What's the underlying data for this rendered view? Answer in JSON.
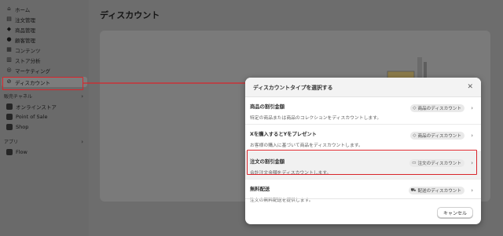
{
  "sidebar": {
    "items": [
      {
        "icon": "home-icon",
        "glyph": "⌂",
        "label": "ホーム"
      },
      {
        "icon": "orders-icon",
        "glyph": "▤",
        "label": "注文管理"
      },
      {
        "icon": "tag-icon",
        "glyph": "◆",
        "label": "商品管理"
      },
      {
        "icon": "person-icon",
        "glyph": "●",
        "label": "顧客管理"
      },
      {
        "icon": "content-icon",
        "glyph": "▦",
        "label": "コンテンツ"
      },
      {
        "icon": "bar-chart-icon",
        "glyph": "▥",
        "label": "ストア分析"
      },
      {
        "icon": "target-icon",
        "glyph": "◎",
        "label": "マーケティング"
      },
      {
        "icon": "discount-icon",
        "glyph": "⊘",
        "label": "ディスカウント"
      }
    ],
    "sales_channels_label": "販売チャネル",
    "channels": [
      {
        "label": "オンラインストア"
      },
      {
        "label": "Point of Sale"
      },
      {
        "label": "Shop"
      }
    ],
    "apps_label": "アプリ",
    "apps": [
      {
        "label": "Flow"
      }
    ]
  },
  "main": {
    "title": "ディスカウント"
  },
  "modal": {
    "title": "ディスカウントタイプを選択する",
    "options": [
      {
        "title": "商品の割引金額",
        "desc": "特定の商品または商品のコレクションをディスカウントします。",
        "badge": "商品のディスカウント",
        "badge_icon": "tag-icon"
      },
      {
        "title": "Xを購入するとYをプレゼント",
        "desc": "お客様の購入に基づいて商品をディスカウントします。",
        "badge": "商品のディスカウント",
        "badge_icon": "tag-icon"
      },
      {
        "title": "注文の割引金額",
        "desc": "合計注文金額をディスカウントします。",
        "badge": "注文のディスカウント",
        "badge_icon": "cart-icon"
      },
      {
        "title": "無料配送",
        "desc": "注文の無料配送を提供します。",
        "badge": "配送のディスカウント",
        "badge_icon": "truck-icon"
      }
    ],
    "cancel_label": "キャンセル"
  },
  "colors": {
    "highlight": "#d9252b",
    "overlay": "#6d6d6d"
  }
}
